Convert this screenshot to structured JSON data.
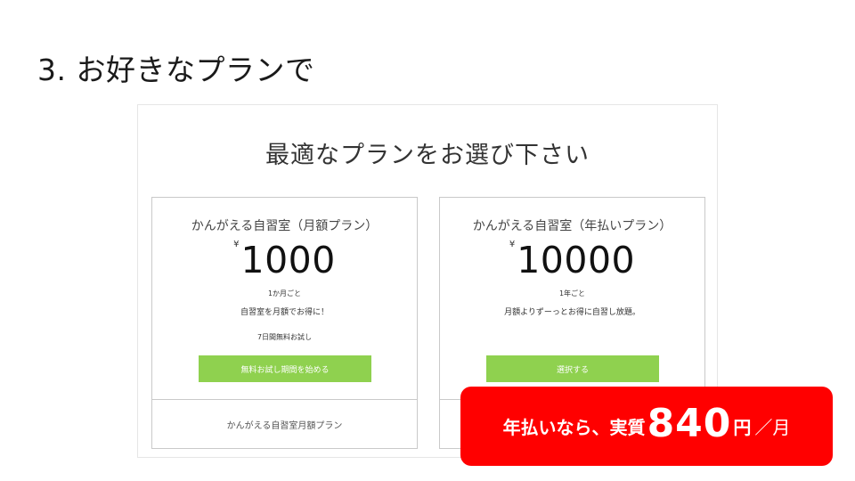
{
  "slide": {
    "title": "3. お好きなプランで"
  },
  "panel": {
    "title": "最適なプランをお選び下さい"
  },
  "plans": [
    {
      "name": "かんがえる自習室（月額プラン）",
      "currency": "¥",
      "price": "1000",
      "period": "1か月ごと",
      "description": "自習室を月額でお得に！",
      "trial": "7日間無料お試し",
      "button": "無料お試し期間を始める",
      "footer": "かんがえる自習室月額プラン"
    },
    {
      "name": "かんがえる自習室（年払いプラン）",
      "currency": "¥",
      "price": "10000",
      "period": "1年ごと",
      "description": "月額よりずーっとお得に自習し放題。",
      "button": "選択する"
    }
  ],
  "promo": {
    "prefix": "年払いなら、実質",
    "amount": "840",
    "unit": "円",
    "suffix": "／月"
  },
  "colors": {
    "cta": "#8fd14f",
    "promo": "#ff0000",
    "border": "#c9c9c9"
  }
}
